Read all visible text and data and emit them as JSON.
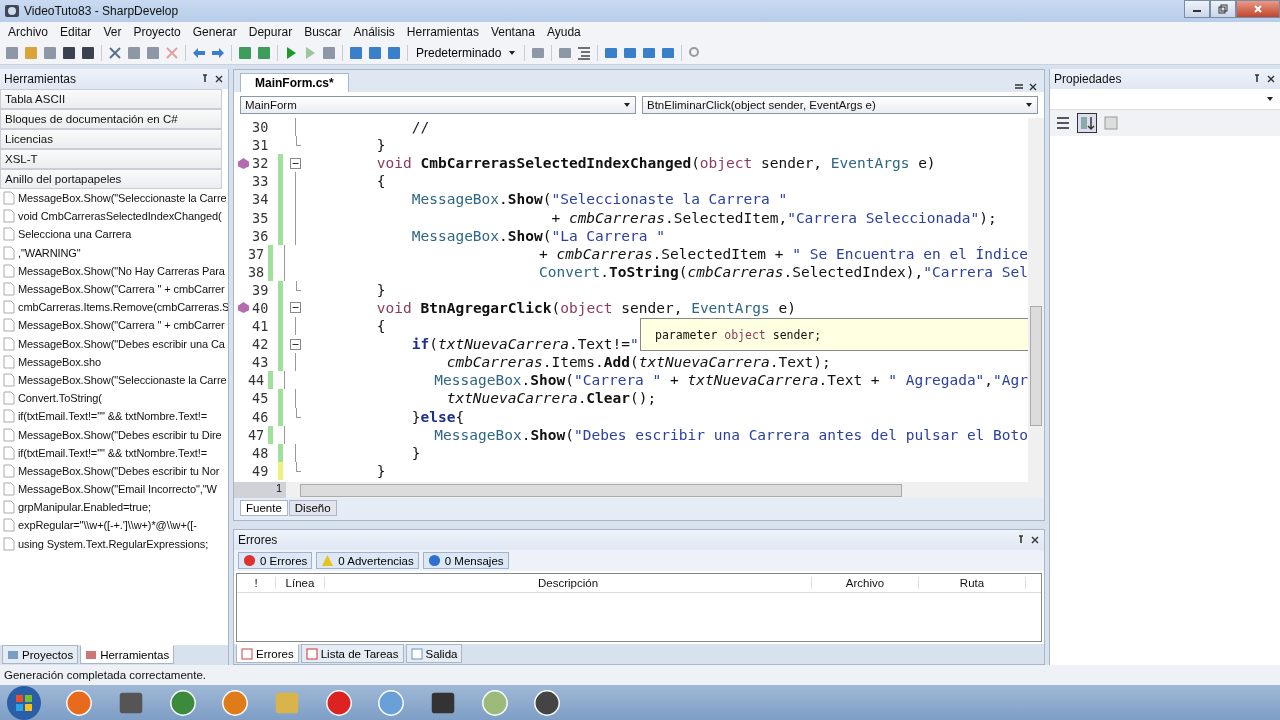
{
  "window": {
    "title": "VideoTuto83 - SharpDevelop"
  },
  "menu": [
    "Archivo",
    "Editar",
    "Ver",
    "Proyecto",
    "Generar",
    "Depurar",
    "Buscar",
    "Análisis",
    "Herramientas",
    "Ventana",
    "Ayuda"
  ],
  "toolbar": {
    "configuration": "Predeterminado"
  },
  "tools_panel": {
    "title": "Herramientas",
    "categories": [
      "Tabla ASCII",
      "Bloques de documentación en C#",
      "Licencias",
      "XSL-T",
      "Anillo del portapapeles"
    ],
    "items": [
      "MessageBox.Show(\"Seleccionaste la Carre",
      "void CmbCarrerasSelectedIndexChanged(",
      "Selecciona una Carrera",
      ",\"WARNING\"",
      "MessageBox.Show(\"No Hay Carreras Para",
      "MessageBox.Show(\"Carrera \" + cmbCarrer",
      "cmbCarreras.Items.Remove(cmbCarreras.S",
      "MessageBox.Show(\"Carrera \" + cmbCarrer",
      "MessageBox.Show(\"Debes escribir una Ca",
      "MessageBox.sho",
      "MessageBox.Show(\"Seleccionaste la Carre",
      "Convert.ToString(",
      "if(txtEmail.Text!=\"\" && txtNombre.Text!=",
      "MessageBox.Show(\"Debes escribir tu Dire",
      "if(txtEmail.Text!=\"\" && txtNombre.Text!=",
      "MessageBox.Show(\"Debes escribir tu Nor",
      "MessageBox.Show(\"Email Incorrecto\",\"W",
      "grpManipular.Enabled=true;",
      "expRegular=\"\\\\w+([-+.']\\\\w+)*@\\\\w+([-",
      "using System.Text.RegularExpressions;"
    ],
    "tabs": [
      {
        "label": "Proyectos",
        "selected": false
      },
      {
        "label": "Herramientas",
        "selected": true
      }
    ]
  },
  "editor": {
    "file_tab": "MainForm.cs*",
    "class_combo": "MainForm",
    "member_combo": "BtnEliminarClick(object sender, EventArgs e)",
    "zoom": "1",
    "lines": [
      {
        "num": "30",
        "bookmark": false,
        "collapsible": false,
        "block_end": false,
        "modified": false,
        "unsaved": false,
        "tokens": [
          {
            "t": "            //",
            "kind": "comment"
          }
        ]
      },
      {
        "num": "31",
        "bookmark": false,
        "collapsible": false,
        "block_end": true,
        "modified": false,
        "unsaved": false,
        "tokens": [
          {
            "t": "        }",
            "kind": "plain"
          }
        ]
      },
      {
        "num": "32",
        "bookmark": true,
        "collapsible": true,
        "block_end": false,
        "modified": true,
        "unsaved": false,
        "tokens": [
          {
            "t": "        void ",
            "kind": "kw"
          },
          {
            "t": "CmbCarrerasSelectedIndexChanged",
            "kind": "method"
          },
          {
            "t": "(",
            "kind": "plain"
          },
          {
            "t": "object",
            "kind": "kw"
          },
          {
            "t": " sender, ",
            "kind": "plain"
          },
          {
            "t": "EventArgs",
            "kind": "type"
          },
          {
            "t": " e)",
            "kind": "plain"
          }
        ]
      },
      {
        "num": "33",
        "bookmark": false,
        "collapsible": false,
        "block_end": false,
        "modified": true,
        "unsaved": false,
        "tokens": [
          {
            "t": "        {",
            "kind": "plain"
          }
        ]
      },
      {
        "num": "34",
        "bookmark": false,
        "collapsible": false,
        "block_end": false,
        "modified": true,
        "unsaved": false,
        "tokens": [
          {
            "t": "            MessageBox",
            "kind": "type"
          },
          {
            "t": ".",
            "kind": "plain"
          },
          {
            "t": "Show",
            "kind": "method"
          },
          {
            "t": "(",
            "kind": "plain"
          },
          {
            "t": "\"Seleccionaste la Carrera \"",
            "kind": "str"
          }
        ]
      },
      {
        "num": "35",
        "bookmark": false,
        "collapsible": false,
        "block_end": false,
        "modified": true,
        "unsaved": false,
        "tokens": [
          {
            "t": "                            + ",
            "kind": "plain"
          },
          {
            "t": "cmbCarreras",
            "kind": "field"
          },
          {
            "t": ".SelectedItem,",
            "kind": "plain"
          },
          {
            "t": "\"Carrera Seleccionada\"",
            "kind": "str"
          },
          {
            "t": ");",
            "kind": "plain"
          }
        ]
      },
      {
        "num": "36",
        "bookmark": false,
        "collapsible": false,
        "block_end": false,
        "modified": true,
        "unsaved": false,
        "tokens": [
          {
            "t": "            MessageBox",
            "kind": "type"
          },
          {
            "t": ".",
            "kind": "plain"
          },
          {
            "t": "Show",
            "kind": "method"
          },
          {
            "t": "(",
            "kind": "plain"
          },
          {
            "t": "\"La Carrera \"",
            "kind": "str"
          }
        ]
      },
      {
        "num": "37",
        "bookmark": false,
        "collapsible": false,
        "block_end": false,
        "modified": true,
        "unsaved": false,
        "tokens": [
          {
            "t": "                            + ",
            "kind": "plain"
          },
          {
            "t": "cmbCarreras",
            "kind": "field"
          },
          {
            "t": ".SelectedItem + ",
            "kind": "plain"
          },
          {
            "t": "\" Se Encuentra en el Índice",
            "kind": "str"
          }
        ]
      },
      {
        "num": "38",
        "bookmark": false,
        "collapsible": false,
        "block_end": false,
        "modified": true,
        "unsaved": false,
        "tokens": [
          {
            "t": "                            Convert",
            "kind": "type"
          },
          {
            "t": ".",
            "kind": "plain"
          },
          {
            "t": "ToString",
            "kind": "method"
          },
          {
            "t": "(",
            "kind": "plain"
          },
          {
            "t": "cmbCarreras",
            "kind": "field"
          },
          {
            "t": ".SelectedIndex),",
            "kind": "plain"
          },
          {
            "t": "\"Carrera Sel",
            "kind": "str"
          }
        ]
      },
      {
        "num": "39",
        "bookmark": false,
        "collapsible": false,
        "block_end": true,
        "modified": true,
        "unsaved": false,
        "tokens": [
          {
            "t": "        }",
            "kind": "plain"
          }
        ]
      },
      {
        "num": "40",
        "bookmark": true,
        "collapsible": true,
        "block_end": false,
        "modified": true,
        "unsaved": false,
        "tokens": [
          {
            "t": "        void ",
            "kind": "kw"
          },
          {
            "t": "BtnAgregarClick",
            "kind": "method"
          },
          {
            "t": "(",
            "kind": "plain"
          },
          {
            "t": "object",
            "kind": "kw"
          },
          {
            "t": " sender, ",
            "kind": "plain"
          },
          {
            "t": "EventArgs",
            "kind": "type"
          },
          {
            "t": " e)",
            "kind": "plain"
          }
        ]
      },
      {
        "num": "41",
        "bookmark": false,
        "collapsible": false,
        "block_end": false,
        "modified": true,
        "unsaved": false,
        "tokens": [
          {
            "t": "        {",
            "kind": "plain"
          }
        ]
      },
      {
        "num": "42",
        "bookmark": false,
        "collapsible": true,
        "block_end": false,
        "modified": true,
        "unsaved": false,
        "tokens": [
          {
            "t": "            if",
            "kind": "ctrl"
          },
          {
            "t": "(",
            "kind": "plain"
          },
          {
            "t": "txtNuevaCarrera",
            "kind": "field"
          },
          {
            "t": ".Text!=",
            "kind": "plain"
          },
          {
            "t": "\"",
            "kind": "str"
          }
        ]
      },
      {
        "num": "43",
        "bookmark": false,
        "collapsible": false,
        "block_end": false,
        "modified": true,
        "unsaved": false,
        "tokens": [
          {
            "t": "                cmbCarreras",
            "kind": "field"
          },
          {
            "t": ".Items.",
            "kind": "plain"
          },
          {
            "t": "Add",
            "kind": "method"
          },
          {
            "t": "(",
            "kind": "plain"
          },
          {
            "t": "txtNuevaCarrera",
            "kind": "field"
          },
          {
            "t": ".Text);",
            "kind": "plain"
          }
        ]
      },
      {
        "num": "44",
        "bookmark": false,
        "collapsible": false,
        "block_end": false,
        "modified": true,
        "unsaved": false,
        "tokens": [
          {
            "t": "                MessageBox",
            "kind": "type"
          },
          {
            "t": ".",
            "kind": "plain"
          },
          {
            "t": "Show",
            "kind": "method"
          },
          {
            "t": "(",
            "kind": "plain"
          },
          {
            "t": "\"Carrera \"",
            "kind": "str"
          },
          {
            "t": " + ",
            "kind": "plain"
          },
          {
            "t": "txtNuevaCarrera",
            "kind": "field"
          },
          {
            "t": ".Text + ",
            "kind": "plain"
          },
          {
            "t": "\" Agregada\"",
            "kind": "str"
          },
          {
            "t": ",",
            "kind": "plain"
          },
          {
            "t": "\"Agr",
            "kind": "str"
          }
        ]
      },
      {
        "num": "45",
        "bookmark": false,
        "collapsible": false,
        "block_end": false,
        "modified": true,
        "unsaved": false,
        "tokens": [
          {
            "t": "                txtNuevaCarrera",
            "kind": "field"
          },
          {
            "t": ".",
            "kind": "plain"
          },
          {
            "t": "Clear",
            "kind": "method"
          },
          {
            "t": "();",
            "kind": "plain"
          }
        ]
      },
      {
        "num": "46",
        "bookmark": false,
        "collapsible": false,
        "block_end": true,
        "modified": true,
        "unsaved": false,
        "tokens": [
          {
            "t": "            }",
            "kind": "plain"
          },
          {
            "t": "else",
            "kind": "ctrl"
          },
          {
            "t": "{",
            "kind": "plain"
          }
        ]
      },
      {
        "num": "47",
        "bookmark": false,
        "collapsible": false,
        "block_end": false,
        "modified": true,
        "unsaved": false,
        "tokens": [
          {
            "t": "                MessageBox",
            "kind": "type"
          },
          {
            "t": ".",
            "kind": "plain"
          },
          {
            "t": "Show",
            "kind": "method"
          },
          {
            "t": "(",
            "kind": "plain"
          },
          {
            "t": "\"Debes escribir una Carrera antes del pulsar el Boto",
            "kind": "str"
          }
        ]
      },
      {
        "num": "48",
        "bookmark": false,
        "collapsible": false,
        "block_end": false,
        "modified": true,
        "unsaved": false,
        "tokens": [
          {
            "t": "            }",
            "kind": "plain"
          }
        ]
      },
      {
        "num": "49",
        "bookmark": false,
        "collapsible": false,
        "block_end": true,
        "modified": false,
        "unsaved": true,
        "tokens": [
          {
            "t": "        }",
            "kind": "plain"
          }
        ]
      }
    ],
    "tooltip": [
      {
        "t": "parameter ",
        "kind": "plain"
      },
      {
        "t": "object",
        "kind": "kw"
      },
      {
        "t": " sender;",
        "kind": "plain"
      }
    ],
    "view_tabs": [
      {
        "label": "Fuente",
        "selected": true
      },
      {
        "label": "Diseño",
        "selected": false
      }
    ]
  },
  "properties_panel": {
    "title": "Propiedades",
    "sort_alphabetical": true
  },
  "errors_panel": {
    "title": "Errores",
    "filters": [
      {
        "kind": "error",
        "label": "0 Errores"
      },
      {
        "kind": "warning",
        "label": "0 Advertencias"
      },
      {
        "kind": "info",
        "label": "0 Mensajes"
      }
    ],
    "columns": [
      "!",
      "Línea",
      "Descripción",
      "Archivo",
      "Ruta"
    ],
    "tabs": [
      {
        "kind": "errors",
        "label": "Errores",
        "selected": true
      },
      {
        "kind": "tasks",
        "label": "Lista de Tareas",
        "selected": false
      },
      {
        "kind": "output",
        "label": "Salida",
        "selected": false
      }
    ]
  },
  "status_bar": {
    "message": "Generación completada correctamente."
  }
}
